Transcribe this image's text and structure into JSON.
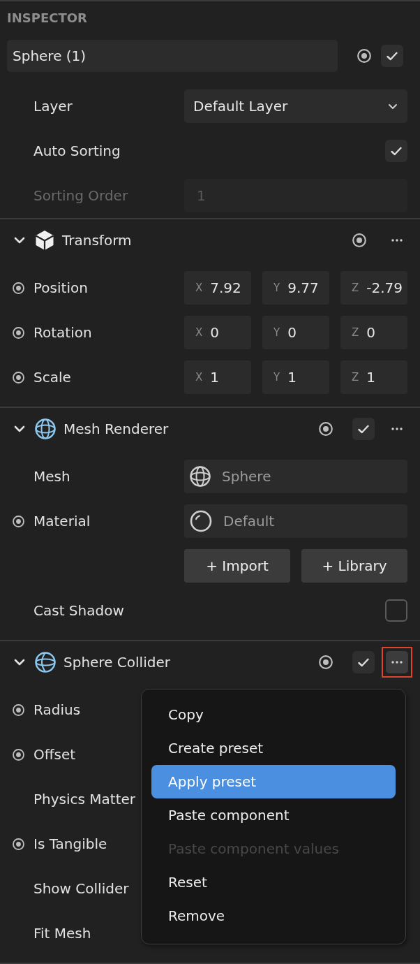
{
  "panel": {
    "title": "INSPECTOR"
  },
  "object": {
    "name": "Sphere (1)",
    "animatable": true,
    "enabled": true
  },
  "object_properties": [
    {
      "kind": "dropdown",
      "label": "Layer",
      "value": "Default Layer",
      "animatable": false,
      "disabled": false
    },
    {
      "kind": "checkbox",
      "label": "Auto Sorting",
      "checked": true,
      "animatable": false,
      "disabled": false
    },
    {
      "kind": "number",
      "label": "Sorting Order",
      "value": "1",
      "animatable": false,
      "disabled": true
    }
  ],
  "components": [
    {
      "kind": "transform",
      "title": "Transform",
      "expanded": true,
      "animatable": true,
      "menu_open": false,
      "highlighted": false,
      "properties": [
        {
          "kind": "vector",
          "label": "Position",
          "animatable": true,
          "axes": [
            {
              "axis": "X",
              "value": "7.92"
            },
            {
              "axis": "Y",
              "value": "9.77"
            },
            {
              "axis": "Z",
              "value": "-2.79"
            }
          ]
        },
        {
          "kind": "vector",
          "label": "Rotation",
          "animatable": true,
          "axes": [
            {
              "axis": "X",
              "value": "0"
            },
            {
              "axis": "Y",
              "value": "0"
            },
            {
              "axis": "Z",
              "value": "0"
            }
          ]
        },
        {
          "kind": "vector",
          "label": "Scale",
          "animatable": true,
          "axes": [
            {
              "axis": "X",
              "value": "1"
            },
            {
              "axis": "Y",
              "value": "1"
            },
            {
              "axis": "Z",
              "value": "1"
            }
          ]
        }
      ]
    },
    {
      "kind": "renderer",
      "title": "Mesh Renderer",
      "expanded": true,
      "animatable": true,
      "enabled": true,
      "menu_open": false,
      "highlighted": false,
      "properties": [
        {
          "kind": "mesh",
          "label": "Mesh",
          "value": "Sphere",
          "animatable": false
        },
        {
          "kind": "material",
          "label": "Material",
          "value": "Default",
          "animatable": true
        },
        {
          "kind": "buttons",
          "buttons": [
            "+ Import",
            "+ Library"
          ],
          "animatable": false
        },
        {
          "kind": "checkbox",
          "label": "Cast Shadow",
          "checked": false,
          "animatable": false
        }
      ]
    },
    {
      "kind": "collider",
      "title": "Sphere Collider",
      "expanded": true,
      "animatable": true,
      "enabled": true,
      "menu_open": true,
      "highlighted": true,
      "properties": [
        {
          "kind": "label",
          "label": "Radius",
          "animatable": true
        },
        {
          "kind": "label",
          "label": "Offset",
          "animatable": true
        },
        {
          "kind": "label",
          "label": "Physics Matter",
          "animatable": false
        },
        {
          "kind": "label",
          "label": "Is Tangible",
          "animatable": true
        },
        {
          "kind": "label",
          "label": "Show Collider",
          "animatable": false
        },
        {
          "kind": "label",
          "label": "Fit Mesh",
          "animatable": false
        }
      ]
    }
  ],
  "context_menu": {
    "items": [
      {
        "label": "Copy",
        "selected": false,
        "disabled": false
      },
      {
        "label": "Create preset",
        "selected": false,
        "disabled": false
      },
      {
        "label": "Apply preset",
        "selected": true,
        "disabled": false
      },
      {
        "label": "Paste component",
        "selected": false,
        "disabled": false
      },
      {
        "label": "Paste component values",
        "selected": false,
        "disabled": true
      },
      {
        "label": "Reset",
        "selected": false,
        "disabled": false
      },
      {
        "label": "Remove",
        "selected": false,
        "disabled": false
      }
    ]
  }
}
